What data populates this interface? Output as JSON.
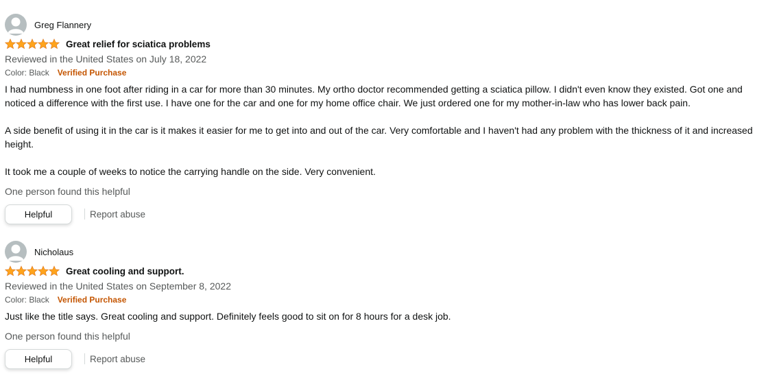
{
  "reviews": [
    {
      "profile_name": "Greg Flannery",
      "rating": 5,
      "title": "Great relief for sciatica problems",
      "date": "Reviewed in the United States on July 18, 2022",
      "format": "Color: Black",
      "verified": "Verified Purchase",
      "body": [
        "I had numbness in one foot after riding in a car for more than 30 minutes. My ortho doctor recommended getting a sciatica pillow. I didn't even know they existed. Got one and noticed a difference with the first use. I have one for the car and one for my home office chair. We just ordered one for my mother-in-law who has lower back pain.",
        "A side benefit of using it in the car is it makes it easier for me to get into and out of the car. Very comfortable and I haven't had any problem with the thickness of it and increased height.",
        "It took me a couple of weeks to notice the carrying handle on the side. Very convenient."
      ],
      "helpful_count": "One person found this helpful",
      "helpful_label": "Helpful",
      "report_label": "Report abuse"
    },
    {
      "profile_name": "Nicholaus",
      "rating": 5,
      "title": "Great cooling and support.",
      "date": "Reviewed in the United States on September 8, 2022",
      "format": "Color: Black",
      "verified": "Verified Purchase",
      "body": [
        "Just like the title says. Great cooling and support. Definitely feels good to sit on for 8 hours for a desk job."
      ],
      "helpful_count": "One person found this helpful",
      "helpful_label": "Helpful",
      "report_label": "Report abuse"
    }
  ],
  "colors": {
    "star": "#ffa41c",
    "verified": "#c45500",
    "muted": "#565959"
  }
}
